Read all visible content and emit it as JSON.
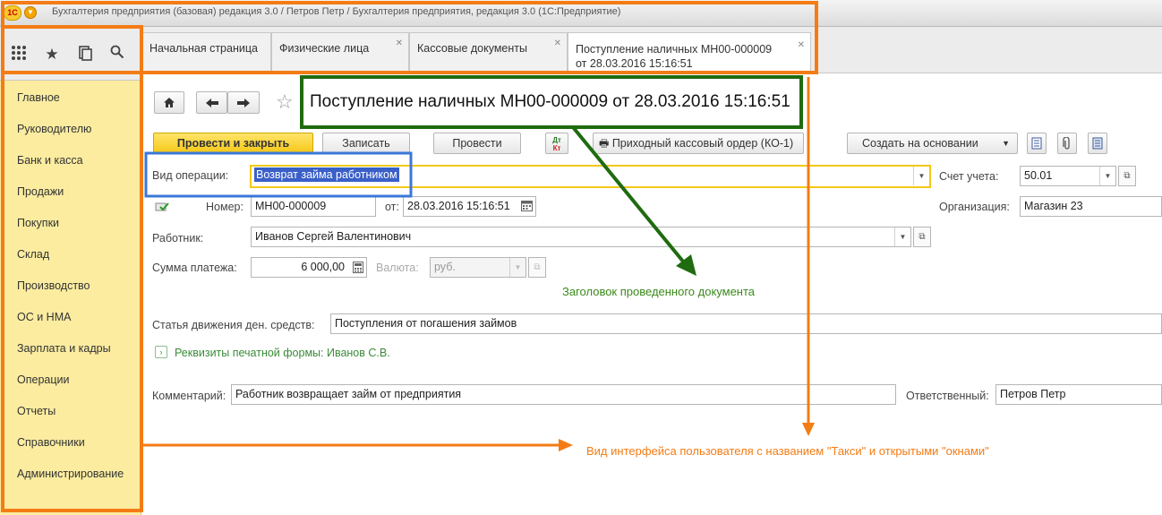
{
  "window": {
    "title": "Бухгалтерия предприятия (базовая) редакция 3.0 / Петров Петр / Бухгалтерия предприятия, редакция 3.0  (1С:Предприятие)",
    "logo_text": "1С"
  },
  "sidebar": {
    "items": [
      "Главное",
      "Руководителю",
      "Банк и касса",
      "Продажи",
      "Покупки",
      "Склад",
      "Производство",
      "ОС и НМА",
      "Зарплата и кадры",
      "Операции",
      "Отчеты",
      "Справочники",
      "Администрирование"
    ]
  },
  "tabs": [
    {
      "label": "Начальная страница"
    },
    {
      "label": "Физические лица"
    },
    {
      "label": "Кассовые документы"
    },
    {
      "label_line1": "Поступление наличных МН00-000009",
      "label_line2": "от 28.03.2016 15:16:51"
    }
  ],
  "doc": {
    "title": "Поступление наличных МН00-000009 от 28.03.2016 15:16:51"
  },
  "toolbar": {
    "post_close": "Провести и закрыть",
    "save": "Записать",
    "post": "Провести",
    "dt_kt_1": "Дт",
    "dt_kt_2": "Кт",
    "print": "Приходный кассовый ордер (КО-1)",
    "create_based": "Создать на основании"
  },
  "form": {
    "op_type_label": "Вид операции:",
    "op_type_value": "Возврат займа работником",
    "account_label": "Счет учета:",
    "account_value": "50.01",
    "number_label": "Номер:",
    "number_value": "МН00-000009",
    "date_label": "от:",
    "date_value": "28.03.2016 15:16:51",
    "org_label": "Организация:",
    "org_value": "Магазин 23",
    "employee_label": "Работник:",
    "employee_value": "Иванов Сергей Валентинович",
    "sum_label": "Сумма платежа:",
    "sum_value": "6 000,00",
    "currency_label": "Валюта:",
    "currency_value": "руб.",
    "cashflow_label": "Статья движения ден. средств:",
    "cashflow_value": "Поступления от погашения займов",
    "print_details": "Реквизиты печатной формы: Иванов С.В.",
    "comment_label": "Комментарий:",
    "comment_value": "Работник возвращает займ от предприятия",
    "responsible_label": "Ответственный:",
    "responsible_value": "Петров Петр"
  },
  "annotations": {
    "green": "Заголовок проведенного документа",
    "orange": "Вид интерфейса пользователя с названием \"Такси\" и открытыми \"окнами\""
  },
  "colors": {
    "sidebar_bg": "#fbeca0",
    "primary_button": "#f5c816",
    "annotation_orange": "#f47c14",
    "annotation_green": "#1f6b0f",
    "annotation_blue": "#3a78d8"
  }
}
